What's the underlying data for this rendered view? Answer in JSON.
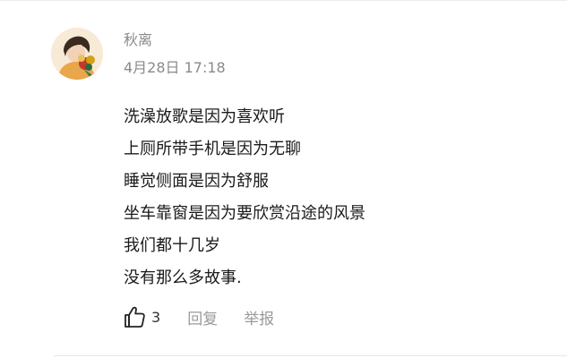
{
  "comment": {
    "user": {
      "name": "秋离",
      "avatar_icon": "user-avatar-holding-flowers"
    },
    "timestamp": "4月28日 17:18",
    "lines": [
      "洗澡放歌是因为喜欢听",
      "上厕所带手机是因为无聊",
      "睡觉侧面是因为舒服",
      "坐车靠窗是因为要欣赏沿途的风景",
      "我们都十几岁",
      "没有那么多故事."
    ],
    "actions": {
      "like_icon": "thumbs-up-icon",
      "like_count": "3",
      "reply_label": "回复",
      "report_label": "举报"
    }
  },
  "colors": {
    "meta_text": "#8a8a8a",
    "body_text": "#1a1a1a",
    "action_text": "#9a9a9a",
    "divider": "#e6e6e6"
  }
}
